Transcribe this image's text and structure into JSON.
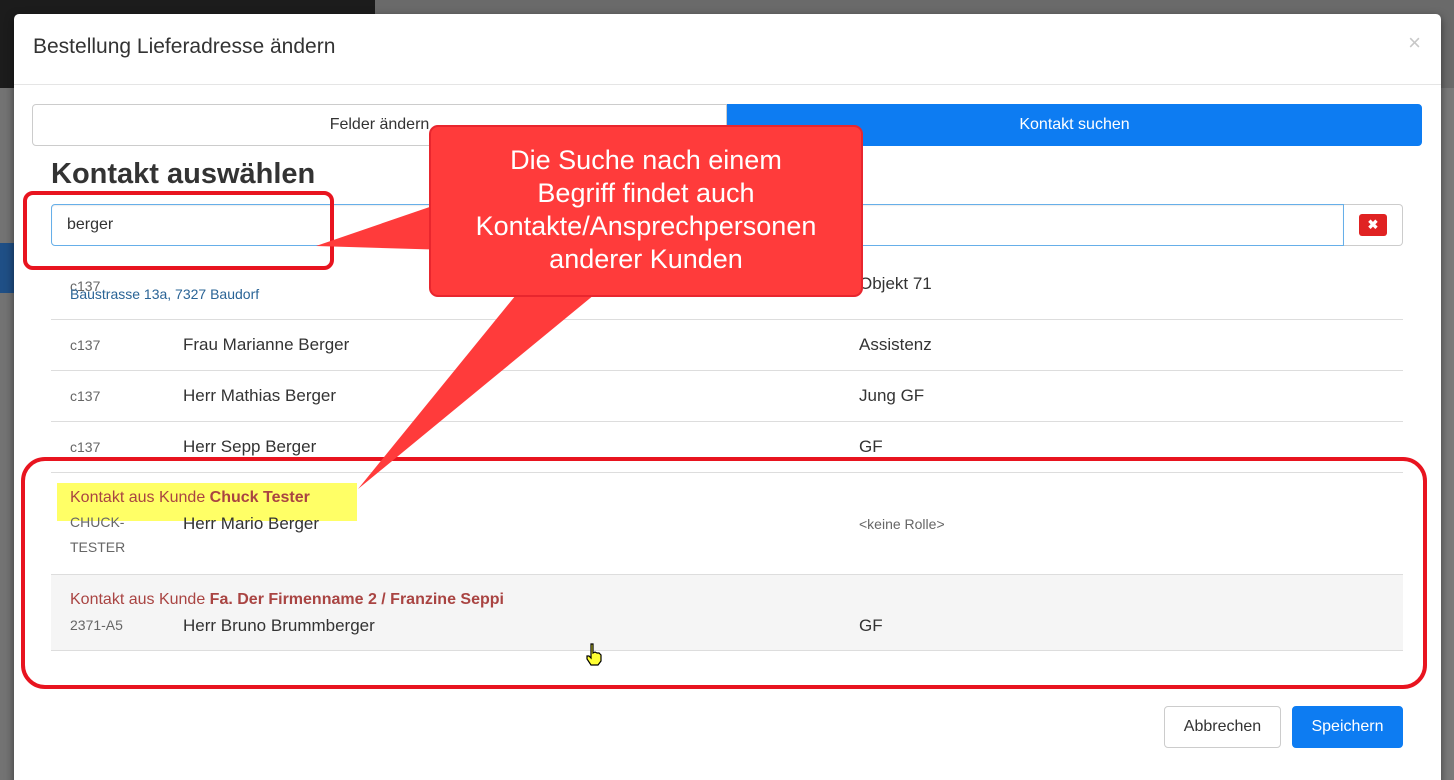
{
  "modal": {
    "title": "Bestellung Lieferadresse ändern",
    "close_symbol": "×"
  },
  "tabs": [
    {
      "label": "Felder ändern",
      "active": false
    },
    {
      "label": "Kontakt suchen",
      "active": true
    }
  ],
  "section_title": "Kontakt auswählen",
  "search": {
    "value": "berger",
    "clear_symbol": "✖"
  },
  "results": [
    {
      "code": "c137",
      "address": "Baustrasse 13a, 7327 Baudorf",
      "role": "Objekt 71"
    },
    {
      "code": "c137",
      "name": "Frau Marianne Berger",
      "role": "Assistenz"
    },
    {
      "code": "c137",
      "name": "Herr Mathias Berger",
      "role": "Jung GF"
    },
    {
      "code": "c137",
      "name": "Herr Sepp Berger",
      "role": "GF"
    },
    {
      "note_prefix": "Kontakt aus Kunde",
      "customer": "Chuck Tester",
      "code_line1": "CHUCK-",
      "code_line2": "TESTER",
      "name": "Herr Mario Berger",
      "role": "<keine Rolle>"
    },
    {
      "note_prefix": "Kontakt aus Kunde",
      "customer": "Fa. Der Firmenname 2 / Franzine Seppi",
      "code": "2371-A5",
      "name": "Herr Bruno Brummberger",
      "role": "GF"
    }
  ],
  "footer": {
    "cancel_label": "Abbrechen",
    "save_label": "Speichern"
  },
  "annotation": {
    "callout_lines": [
      "Die Suche nach einem",
      "Begriff findet auch",
      "Kontakte/Ansprechpersonen",
      "anderer Kunden"
    ],
    "color": "#ff3b3b",
    "outline_color": "#e8141f"
  },
  "colors": {
    "primary": "#0d7cf2",
    "danger": "#e02222",
    "highlight": "#ffff66",
    "note_text": "#a94442"
  }
}
